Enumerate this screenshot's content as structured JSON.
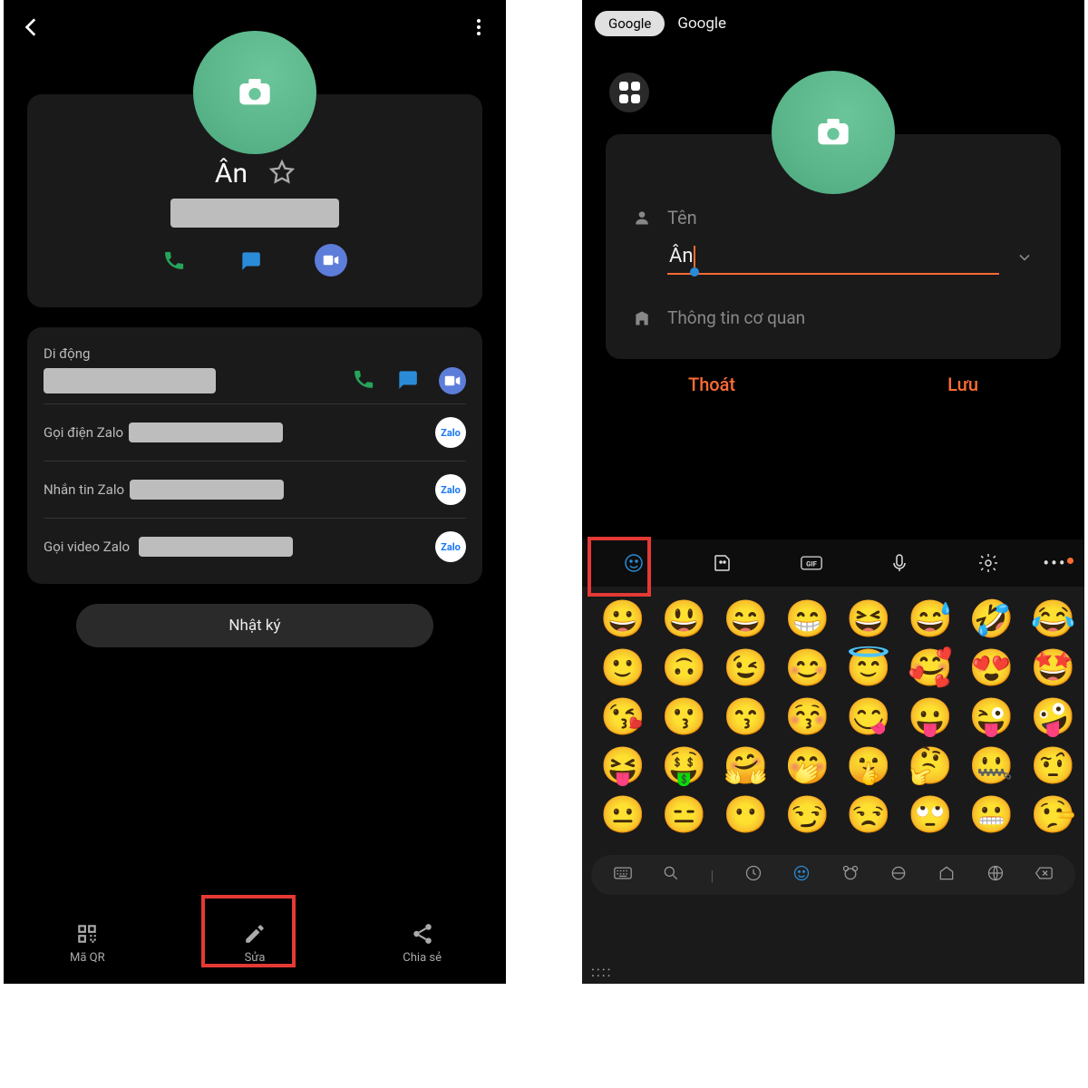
{
  "left": {
    "contact_name": "Ân",
    "mobile_label": "Di động",
    "zalo_call": "Gọi điện Zalo",
    "zalo_msg": "Nhắn tin Zalo",
    "zalo_video": "Gọi video Zalo",
    "zalo_badge": "Zalo",
    "log_button": "Nhật ký",
    "nav": {
      "qr": "Mã QR",
      "edit": "Sửa",
      "share": "Chia sẻ"
    }
  },
  "right": {
    "chip_sel": "Google",
    "chip": "Google",
    "name_label": "Tên",
    "name_value": "Ân",
    "org_placeholder": "Thông tin cơ quan",
    "cancel": "Thoát",
    "save": "Lưu",
    "emojis": [
      "😀",
      "😃",
      "😄",
      "😁",
      "😆",
      "😅",
      "🤣",
      "😂",
      "🙂",
      "🙃",
      "😉",
      "😊",
      "😇",
      "🥰",
      "😍",
      "🤩",
      "😘",
      "😗",
      "😙",
      "😚",
      "😋",
      "😛",
      "😜",
      "🤪",
      "😝",
      "🤑",
      "🤗",
      "🤭",
      "🤫",
      "🤔",
      "🤐",
      "🤨",
      "😐",
      "😑",
      "😶",
      "😏",
      "😒",
      "🙄",
      "😬",
      "🤥"
    ]
  }
}
